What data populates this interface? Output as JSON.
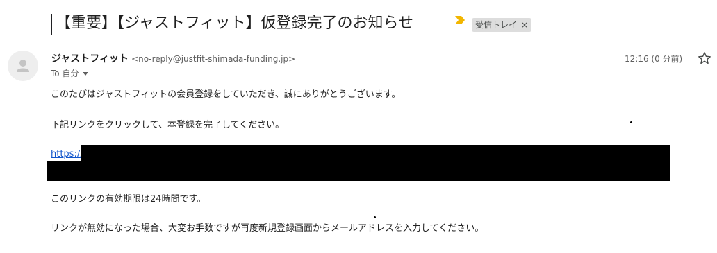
{
  "email": {
    "subject": "【重要】【ジャストフィット】仮登録完了のお知らせ",
    "label": "受信トレイ",
    "label_close": "×",
    "sender": {
      "name": "ジャストフィット",
      "email": "<no-reply@justfit-shimada-funding.jp>"
    },
    "to": "To 自分",
    "time": "12:16 (0 分前)",
    "body": {
      "line1": "このたびはジャストフィットの会員登録をしていただき、誠にありがとうございます。",
      "line2": "下記リンクをクリックして、本登録を完了してください。",
      "link_visible": "https://",
      "line3": "このリンクの有効期限は24時間です。",
      "line4": "リンクが無効になった場合、大変お手数ですが再度新規登録画面からメールアドレスを入力してください。"
    }
  },
  "icons": {
    "important": "important-marker-icon",
    "avatar": "default-avatar-icon",
    "star": "star-icon",
    "caret": "chevron-down-icon"
  },
  "colors": {
    "important_marker": "#f2b600",
    "link": "#1155cc",
    "redaction": "#000000"
  }
}
